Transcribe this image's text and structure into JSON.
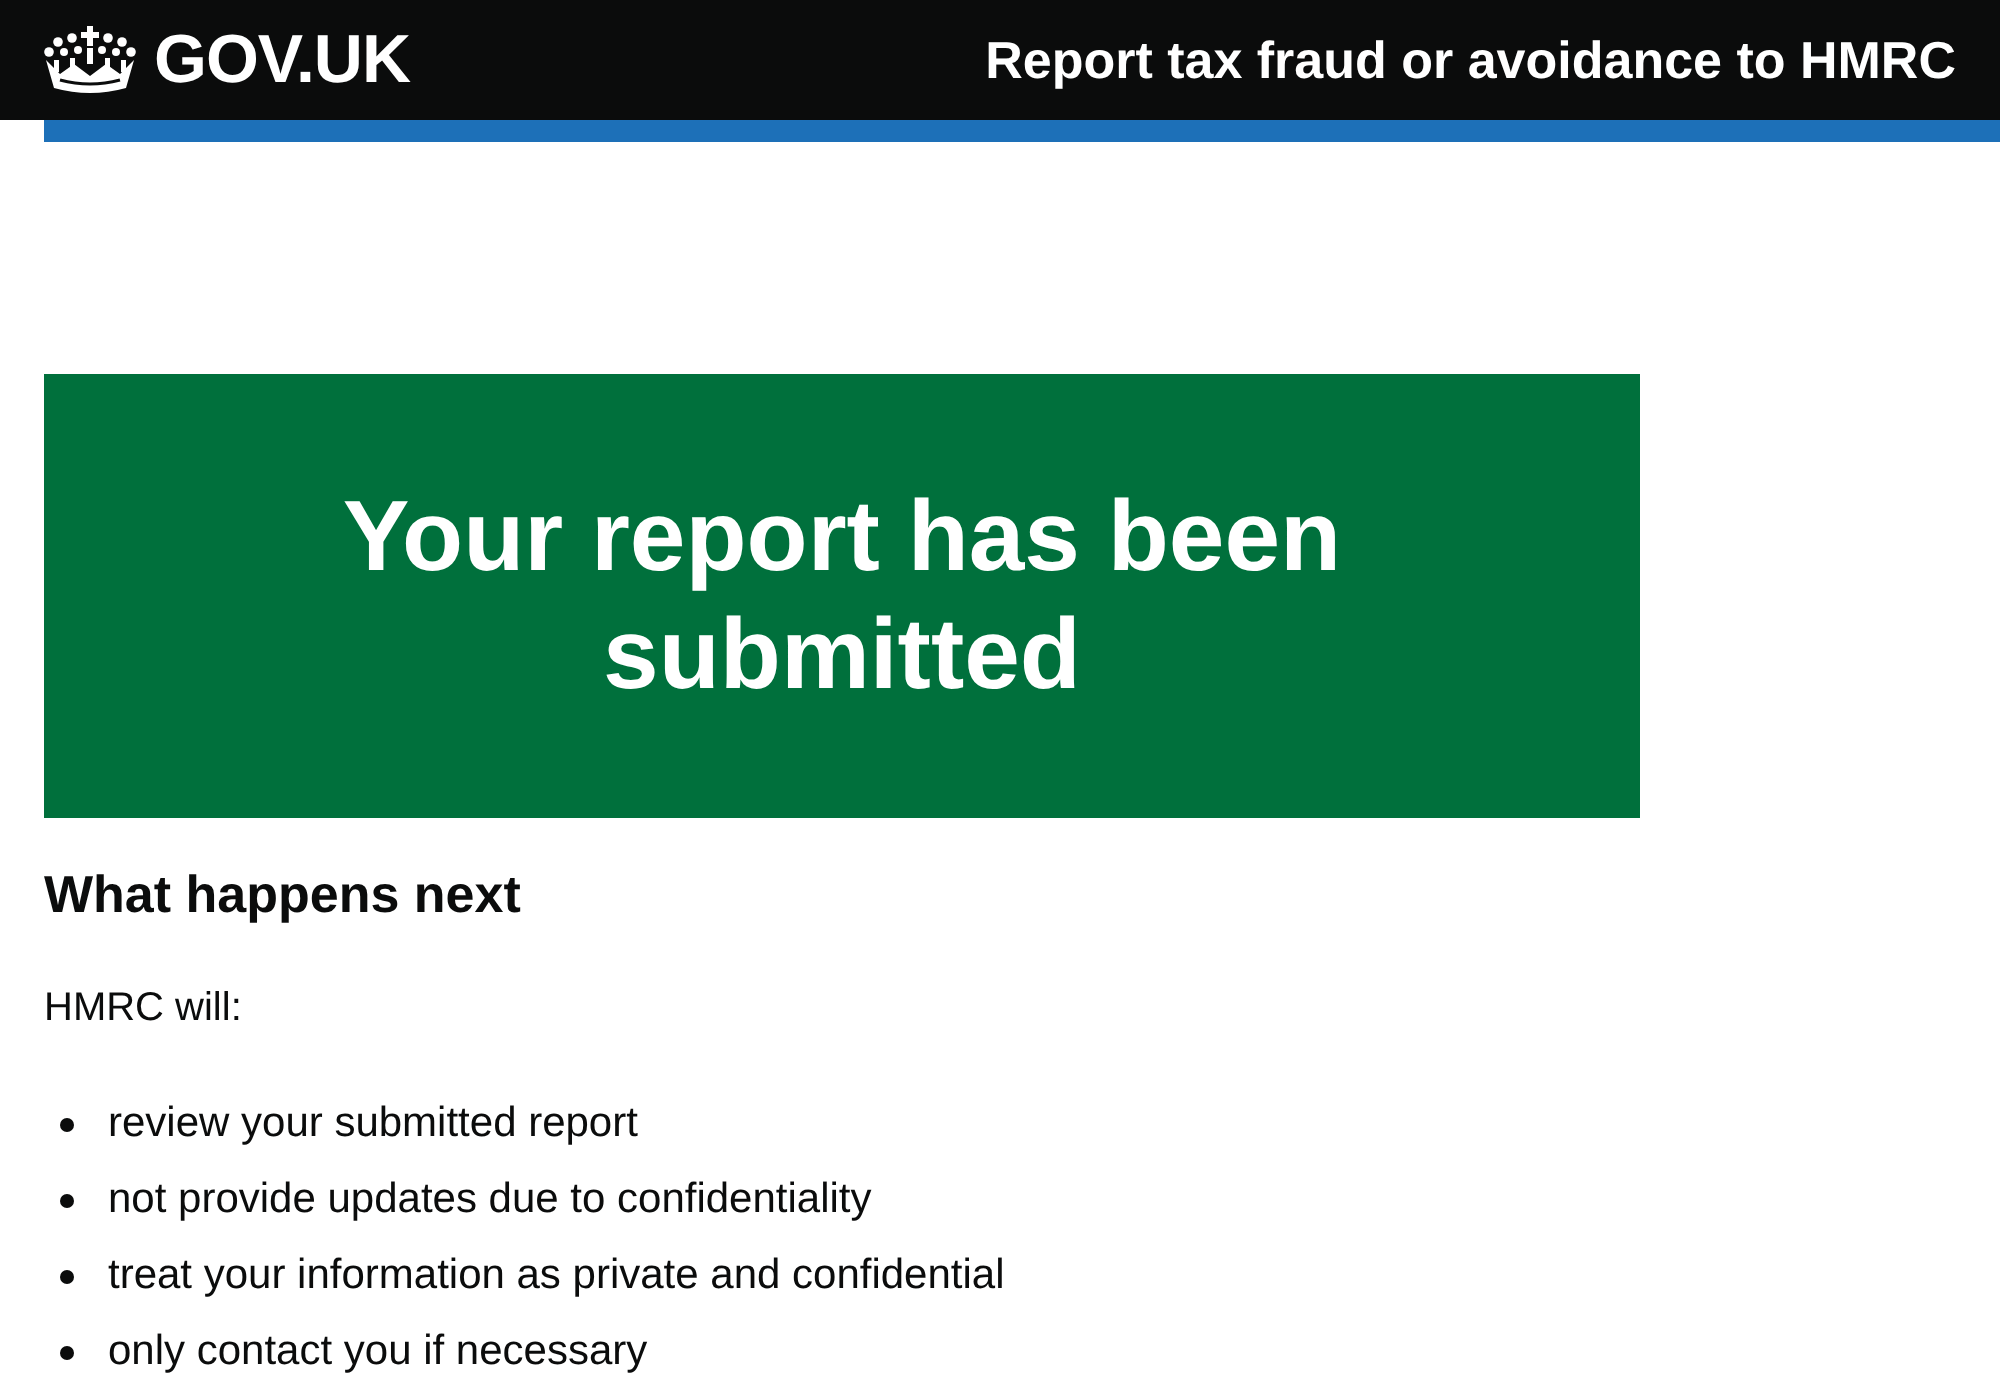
{
  "header": {
    "logo": "GOV.UK",
    "service_name": "Report tax fraud or avoidance to HMRC"
  },
  "confirmation_panel": {
    "title": "Your report has been submitted"
  },
  "next_steps": {
    "heading": "What happens next",
    "intro": "HMRC will:",
    "items": [
      "review your submitted report",
      "not provide updates due to confidentiality",
      "treat your information as private and confidential",
      "only contact you if necessary"
    ]
  }
}
